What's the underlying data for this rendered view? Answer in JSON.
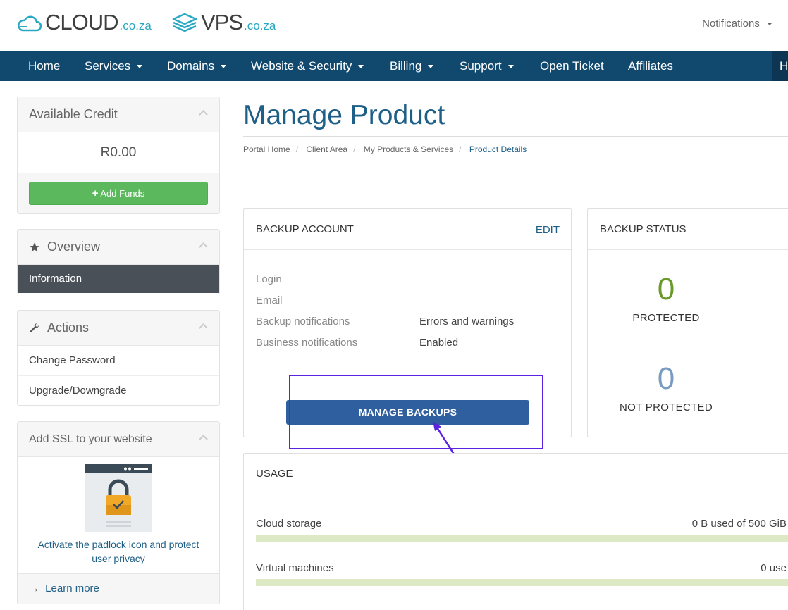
{
  "header": {
    "brand1": {
      "name": "CLOUD",
      "tld": ".co.za"
    },
    "brand2": {
      "name": "VPS",
      "tld": ".co.za"
    },
    "notifications_label": "Notifications"
  },
  "nav": {
    "items": [
      {
        "label": "Home",
        "dropdown": false
      },
      {
        "label": "Services",
        "dropdown": true
      },
      {
        "label": "Domains",
        "dropdown": true
      },
      {
        "label": "Website & Security",
        "dropdown": true
      },
      {
        "label": "Billing",
        "dropdown": true
      },
      {
        "label": "Support",
        "dropdown": true
      },
      {
        "label": "Open Ticket",
        "dropdown": false
      },
      {
        "label": "Affiliates",
        "dropdown": false
      }
    ],
    "right_item": "H"
  },
  "sidebar": {
    "credit": {
      "title": "Available Credit",
      "amount": "R0.00",
      "button": "Add Funds"
    },
    "overview": {
      "title": "Overview",
      "active_item": "Information"
    },
    "actions": {
      "title": "Actions",
      "items": [
        "Change Password",
        "Upgrade/Downgrade"
      ]
    },
    "ssl": {
      "title": "Add SSL to your website",
      "text": "Activate the padlock icon and protect user privacy",
      "link": "Learn more"
    }
  },
  "main": {
    "title": "Manage Product",
    "breadcrumb": [
      "Portal Home",
      "Client Area",
      "My Products & Services",
      "Product Details"
    ],
    "backup_account": {
      "title": "BACKUP ACCOUNT",
      "edit": "EDIT",
      "rows": [
        {
          "label": "Login",
          "value": ""
        },
        {
          "label": "Email",
          "value": ""
        },
        {
          "label": "Backup notifications",
          "value": "Errors and warnings"
        },
        {
          "label": "Business notifications",
          "value": "Enabled"
        }
      ],
      "button": "MANAGE BACKUPS"
    },
    "backup_status": {
      "title": "BACKUP STATUS",
      "protected": {
        "value": "0",
        "label": "PROTECTED",
        "color": "#6a9a2a"
      },
      "not_protected": {
        "value": "0",
        "label": "NOT PROTECTED",
        "color": "#7a9cc0"
      }
    },
    "usage": {
      "title": "USAGE",
      "rows": [
        {
          "label": "Cloud storage",
          "value": "0 B used of 500 GiB",
          "percent": 0
        },
        {
          "label": "Virtual machines",
          "value": "0 use",
          "percent": 0
        }
      ]
    }
  },
  "colors": {
    "nav_bg": "#11486d",
    "primary_text": "#1d5f86",
    "add_funds": "#5cb85c",
    "manage_button": "#2f5f9e",
    "highlight": "#5b22e0"
  }
}
